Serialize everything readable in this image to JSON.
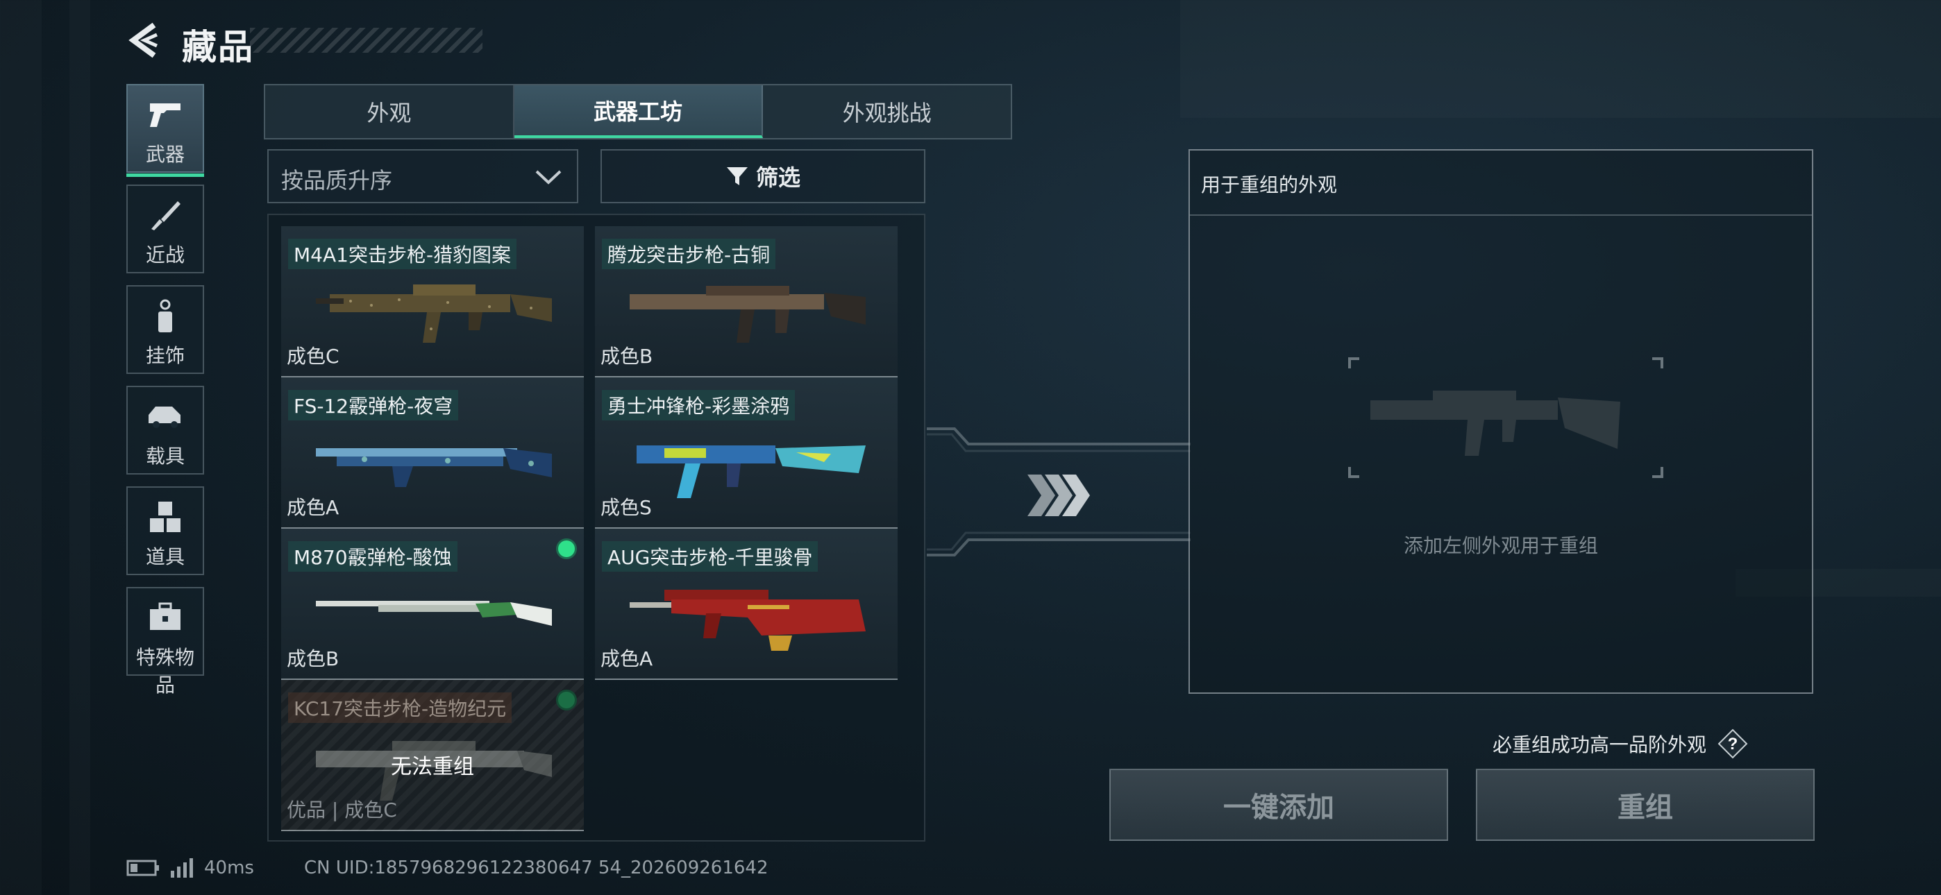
{
  "header": {
    "title": "藏品"
  },
  "sidebar": {
    "items": [
      {
        "label": "武器",
        "icon": "pistol-icon",
        "active": true
      },
      {
        "label": "近战",
        "icon": "knife-icon",
        "active": false
      },
      {
        "label": "挂饰",
        "icon": "charm-icon",
        "active": false
      },
      {
        "label": "载具",
        "icon": "vehicle-icon",
        "active": false
      },
      {
        "label": "道具",
        "icon": "cubes-icon",
        "active": false
      },
      {
        "label": "特殊物品",
        "icon": "toolbox-icon",
        "active": false
      }
    ]
  },
  "tabs": [
    {
      "label": "外观",
      "active": false
    },
    {
      "label": "武器工坊",
      "active": true
    },
    {
      "label": "外观挑战",
      "active": false
    }
  ],
  "sort": {
    "label": "按品质升序"
  },
  "filter": {
    "label": "筛选"
  },
  "items": [
    {
      "name": "M4A1突击步枪-猎豹图案",
      "grade": "成色C",
      "equipped": false,
      "disabled": false
    },
    {
      "name": "腾龙突击步枪-古铜",
      "grade": "成色B",
      "equipped": false,
      "disabled": false
    },
    {
      "name": "FS-12霰弹枪-夜穹",
      "grade": "成色A",
      "equipped": false,
      "disabled": false
    },
    {
      "name": "勇士冲锋枪-彩墨涂鸦",
      "grade": "成色S",
      "equipped": false,
      "disabled": false
    },
    {
      "name": "M870霰弹枪-酸蚀",
      "grade": "成色B",
      "equipped": true,
      "disabled": false
    },
    {
      "name": "AUG突击步枪-千里骏骨",
      "grade": "成色A",
      "equipped": false,
      "disabled": false
    },
    {
      "name": "KC17突击步枪-造物纪元",
      "grade": "优品 | 成色C",
      "equipped": true,
      "disabled": true,
      "overlay": "无法重组"
    }
  ],
  "recombine": {
    "title": "用于重组的外观",
    "hint": "添加左侧外观用于重组",
    "guarantee": "必重组成功高一品阶外观",
    "add_all_label": "一键添加",
    "recombine_label": "重组"
  },
  "status": {
    "ping": "40ms",
    "uid": "CN UID:1857968296122380647 54_202609261642"
  },
  "colors": {
    "accent": "#3fd8a2",
    "equipped_dot": "#2fe08a"
  }
}
